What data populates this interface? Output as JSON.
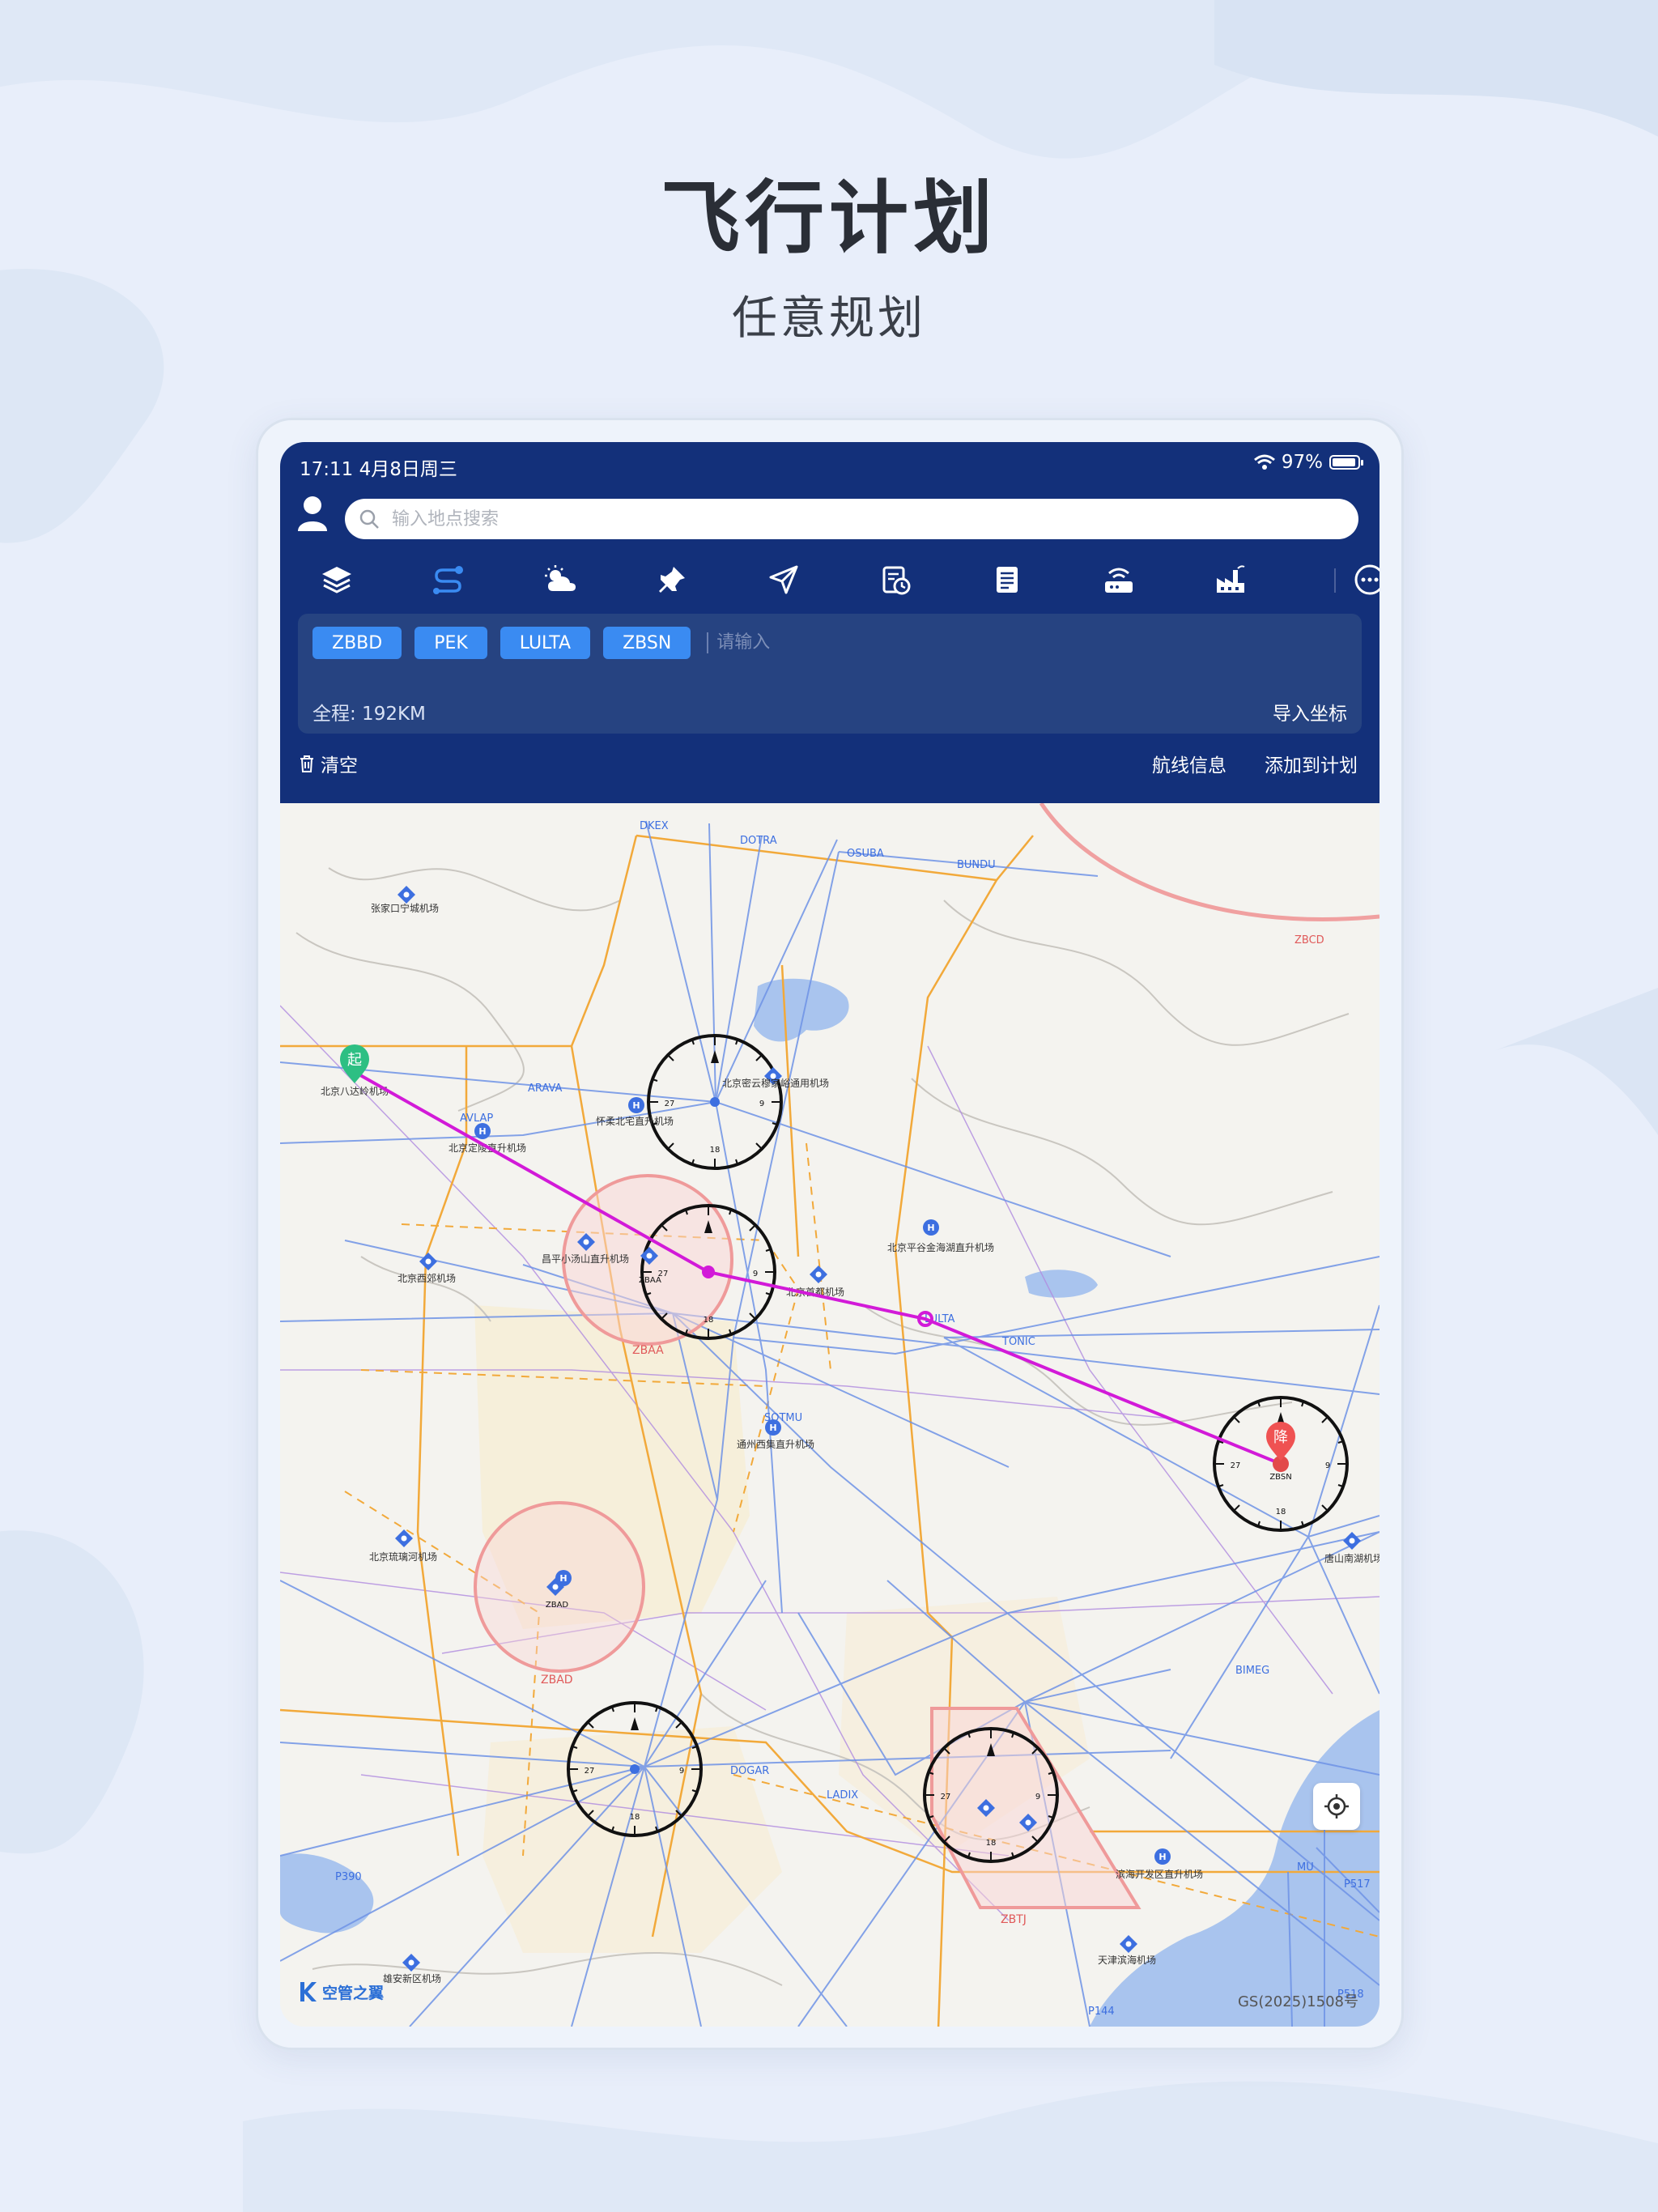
{
  "hero": {
    "title": "飞行计划",
    "subtitle": "任意规划"
  },
  "status": {
    "time": "17:11  4月8日周三",
    "battery": "97%"
  },
  "search": {
    "placeholder": "输入地点搜索"
  },
  "toolbar": {
    "icons": [
      "layers-icon",
      "route-icon",
      "weather-icon",
      "pin-icon",
      "navigate-icon",
      "calendar-clock-icon",
      "document-icon",
      "router-icon",
      "factory-icon",
      "more-icon"
    ],
    "active_color": "#3a8bf2"
  },
  "route": {
    "waypoints": [
      "ZBBD",
      "PEK",
      "LULTA",
      "ZBSN"
    ],
    "input_placeholder": "请输入",
    "total": "全程: 192KM",
    "import_label": "导入坐标"
  },
  "actions": {
    "clear": "清空",
    "route_info": "航线信息",
    "add_plan": "添加到计划"
  },
  "map": {
    "start_badge": "起",
    "end_badge": "降",
    "route_color": "#d21ad8",
    "airports": [
      {
        "name": "张家口宁城机场"
      },
      {
        "name": "北京八达岭机场"
      },
      {
        "name": "北京密云穆家峪通用机场"
      },
      {
        "name": "怀柔北宅直升机场"
      },
      {
        "name": "北京定陵直升机场"
      },
      {
        "name": "昌平小汤山直升机场"
      },
      {
        "name": "北京平谷金海湖直升机场"
      },
      {
        "name": "北京首都机场"
      },
      {
        "name": "北京西郊机场"
      },
      {
        "name": "通州西集直升机场"
      },
      {
        "name": "北京琉璃河机场"
      },
      {
        "name": "唐山南湖机场"
      },
      {
        "name": "滨海开发区直升机场"
      },
      {
        "name": "天津滨海机场"
      },
      {
        "name": "雄安新区机场"
      }
    ],
    "waypoint_labels": [
      "DKEX",
      "DOTRA",
      "OSUBA",
      "BUNDU",
      "ARAVA",
      "AVLAP",
      "LULTA",
      "TONIC",
      "SOTMU",
      "BIMEG",
      "DOGAR",
      "LADIX",
      "P390",
      "P144",
      "P518",
      "P517",
      "MU"
    ],
    "zones": [
      "ZBAA",
      "ZBAD",
      "ZBTJ",
      "ZBCD",
      "ZBAA",
      "ZBAD",
      "ZBSN"
    ],
    "brand": "空管之翼",
    "gs": "GS(2025)1508号"
  }
}
